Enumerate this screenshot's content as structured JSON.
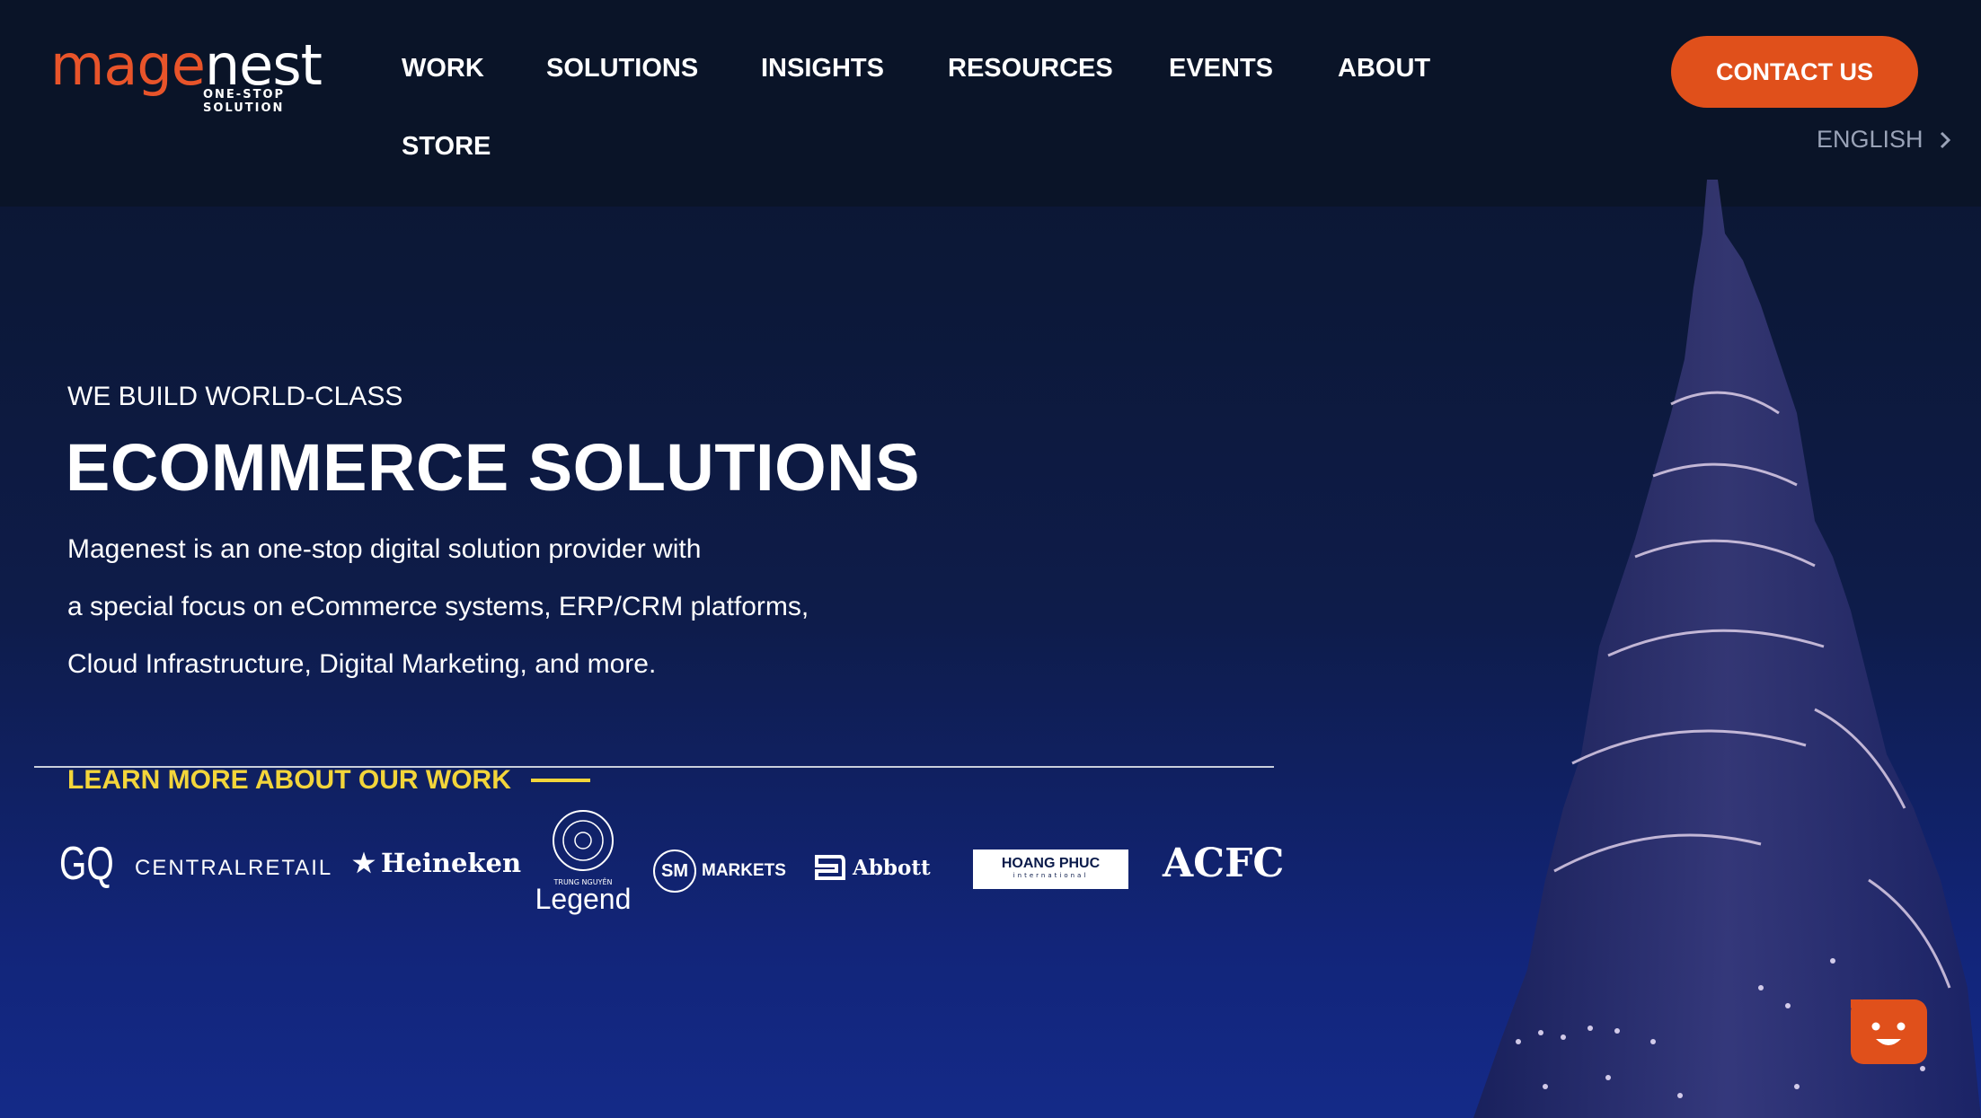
{
  "brand": {
    "logo_orange": "mage",
    "logo_white": "nest",
    "tagline": "ONE-STOP SOLUTION"
  },
  "nav": {
    "items": [
      "WORK",
      "SOLUTIONS",
      "INSIGHTS",
      "RESOURCES",
      "EVENTS",
      "ABOUT",
      "STORE"
    ],
    "contact_label": "CONTACT US",
    "language_label": "ENGLISH"
  },
  "hero": {
    "eyebrow": "WE BUILD WORLD-CLASS",
    "headline": "ECOMMERCE SOLUTIONS",
    "description_lines": [
      "Magenest is an one-stop digital solution provider with",
      "a special focus on eCommerce systems, ERP/CRM platforms,",
      "Cloud Infrastructure, Digital Marketing, and more."
    ],
    "learn_more_label": "LEARN MORE ABOUT OUR WORK"
  },
  "clients": {
    "gq": "GQ",
    "central": "CENTRALRETAIL",
    "heineken": "Heineken",
    "legend": "Legend",
    "legend_small": "TRUNG NGUYÊN",
    "sm": "SM",
    "markets": "MARKETS",
    "abbott": "Abbott",
    "hoang_phuc": "HOANG PHUC",
    "hoang_phuc_sub": "international",
    "acfc": "ACFC"
  },
  "colors": {
    "accent": "#e0501b",
    "highlight": "#f3d53a",
    "background": "#0b1530"
  }
}
